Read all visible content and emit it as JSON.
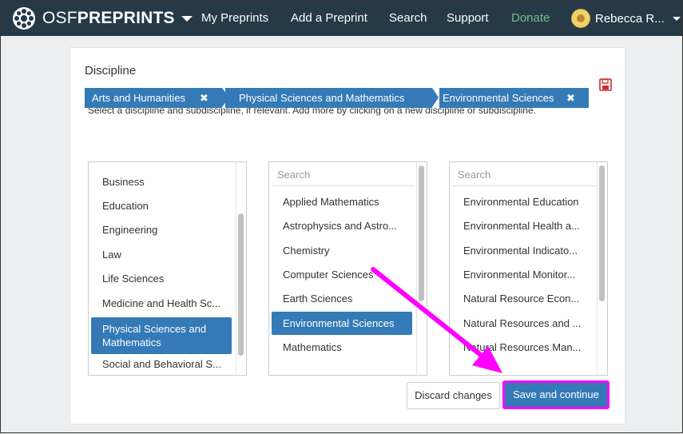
{
  "nav": {
    "brand_light": "OSF",
    "brand_bold": "PREPRINTS",
    "links": [
      "My Preprints",
      "Add a Preprint",
      "Search",
      "Support",
      "Donate"
    ],
    "user": "Rebecca R..."
  },
  "panel": {
    "title": "Discipline",
    "instructions": "Select a discipline and subdiscipline, if relevant. Add more by clicking on a new discipline or subdiscipline."
  },
  "breadcrumbs": [
    "Arts and Humanities",
    "Physical Sciences and Mathematics",
    "Environmental Sciences"
  ],
  "columns": [
    {
      "search": "",
      "items": [
        "Business",
        "Education",
        "Engineering",
        "Law",
        "Life Sciences",
        "Medicine and Health Sc...",
        "Physical Sciences and Mathematics",
        "Social and Behavioral S..."
      ],
      "selected_index": 6
    },
    {
      "search": "Search",
      "items": [
        "Applied Mathematics",
        "Astrophysics and Astro...",
        "Chemistry",
        "Computer Sciences",
        "Earth Sciences",
        "Environmental Sciences",
        "Mathematics"
      ],
      "selected_index": 5
    },
    {
      "search": "Search",
      "items": [
        "Environmental Education",
        "Environmental Health a...",
        "Environmental Indicato...",
        "Environmental Monitor...",
        "Natural Resource Econ...",
        "Natural Resources and ...",
        "Natural Resources Man..."
      ],
      "selected_index": -1
    }
  ],
  "buttons": {
    "discard": "Discard changes",
    "save": "Save and continue"
  },
  "colors": {
    "navbar": "#263947",
    "accent": "#337ab7",
    "donate": "#77c181",
    "annotation": "#ff00ff"
  }
}
